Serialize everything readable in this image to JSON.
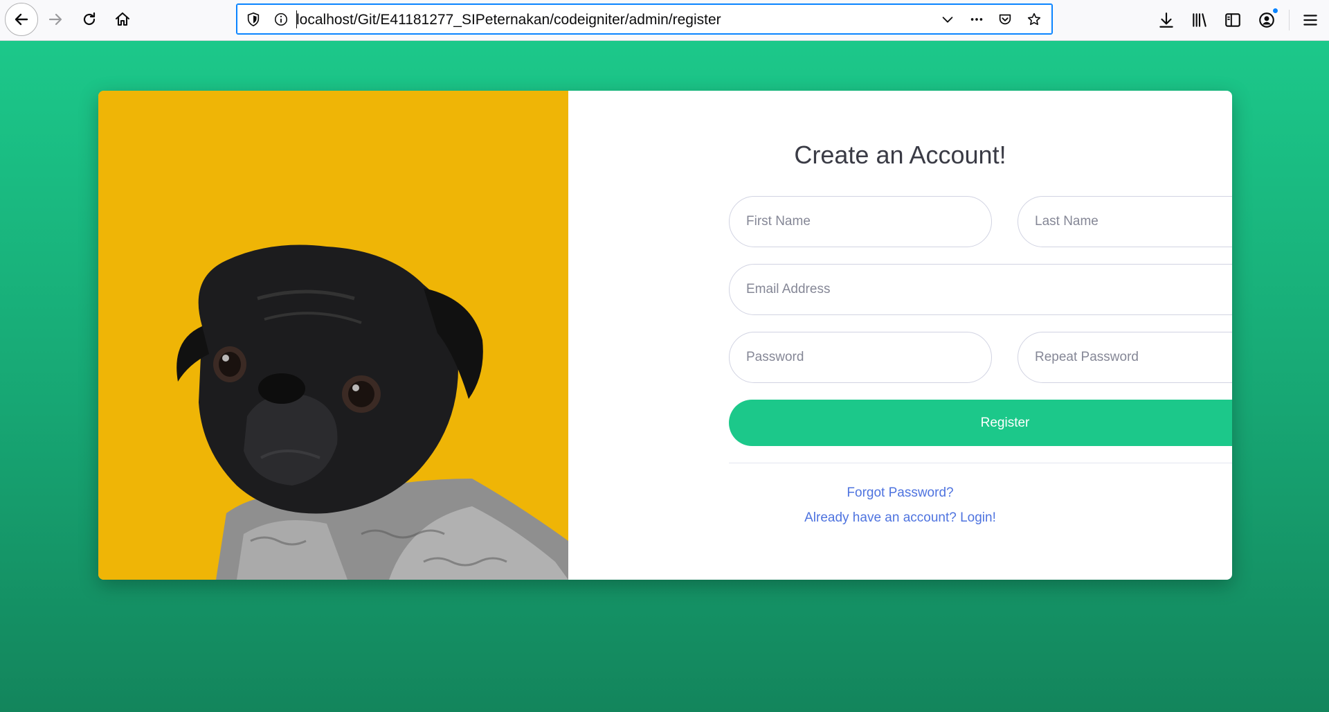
{
  "browser": {
    "url": "localhost/Git/E41181277_SIPeternakan/codeigniter/admin/register",
    "icons": {
      "back": "arrow-left-icon",
      "forward": "arrow-right-icon",
      "reload": "reload-icon",
      "home": "home-icon",
      "tracking": "shield-icon",
      "site_info": "info-icon",
      "url_dropdown": "chevron-down-icon",
      "page_actions": "more-icon",
      "pocket": "pocket-icon",
      "bookmark": "star-icon",
      "downloads": "download-icon",
      "library": "library-icon",
      "sidebars": "sidebar-icon",
      "account": "account-icon",
      "menu": "hamburger-icon"
    }
  },
  "register": {
    "title": "Create an Account!",
    "first_name_placeholder": "First Name",
    "last_name_placeholder": "Last Name",
    "email_placeholder": "Email Address",
    "password_placeholder": "Password",
    "repeat_password_placeholder": "Repeat Password",
    "register_label": "Register",
    "forgot_link": "Forgot Password?",
    "login_link": "Already have an account? Login!"
  },
  "colors": {
    "primary_green": "#1cc88a",
    "link_blue": "#4e73df",
    "image_background": "#efb506",
    "title_text": "#3a3b45"
  }
}
